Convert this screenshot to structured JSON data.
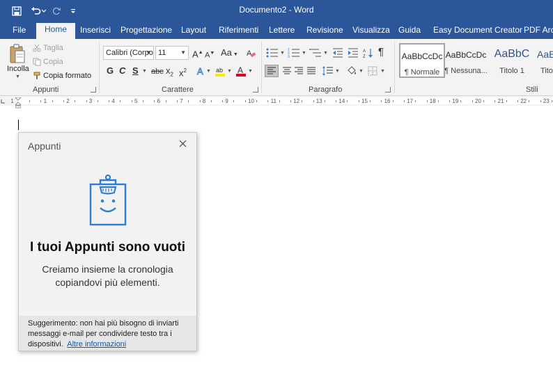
{
  "window": {
    "title": "Documento2 - Word"
  },
  "colors": {
    "accent": "#2b579a",
    "panel_bg": "#f2f2f2",
    "icon_blue": "#2d7dd2",
    "link": "#0a59b2"
  },
  "quick_access": {
    "save_icon": "save-icon",
    "undo_icon": "undo-icon",
    "redo_icon": "redo-icon",
    "customize_icon": "customize-qat-icon"
  },
  "tabs": [
    "File",
    "Home",
    "Inserisci",
    "Progettazione",
    "Layout",
    "Riferimenti",
    "Lettere",
    "Revisione",
    "Visualizza",
    "Guida",
    "Easy Document Creator",
    "PDF Arch"
  ],
  "active_tab": "Home",
  "ribbon": {
    "clipboard": {
      "paste": "Incolla",
      "cut": "Taglia",
      "copy": "Copia",
      "format_painter": "Copia formato",
      "label": "Appunti"
    },
    "font": {
      "font_name": "Calibri (Corpo",
      "font_size": "11",
      "grow": "A",
      "shrink": "A",
      "change_case": "Aa",
      "bold": "G",
      "italic": "C",
      "underline": "S",
      "strikethrough": "abc",
      "subscript": "x",
      "superscript": "x",
      "label": "Carattere"
    },
    "paragraph": {
      "show_marks": "¶",
      "label": "Paragrafo"
    },
    "styles": {
      "items": [
        {
          "sample": "AaBbCcDc",
          "name": "¶ Normale"
        },
        {
          "sample": "AaBbCcDc",
          "name": "¶ Nessuna..."
        },
        {
          "sample": "AaBbC",
          "name": "Titolo 1"
        },
        {
          "sample": "AaBbC",
          "name": "Tito"
        }
      ],
      "label": "Stili"
    }
  },
  "ruler": {
    "numbers": [
      "1",
      "1",
      "2",
      "3",
      "4",
      "5",
      "6",
      "7",
      "8",
      "9",
      "10",
      "11",
      "12",
      "13",
      "14",
      "15",
      "16",
      "17",
      "18",
      "19",
      "20",
      "21",
      "22",
      "23"
    ]
  },
  "clipboard_pane": {
    "title": "Appunti",
    "heading": "I tuoi Appunti sono vuoti",
    "body": "Creiamo insieme la cronologia copiandovi più elementi.",
    "tip": "Suggerimento: non hai più bisogno di inviarti messaggi e-mail per condividere testo tra i dispositivi.",
    "link": "Altre informazioni"
  }
}
